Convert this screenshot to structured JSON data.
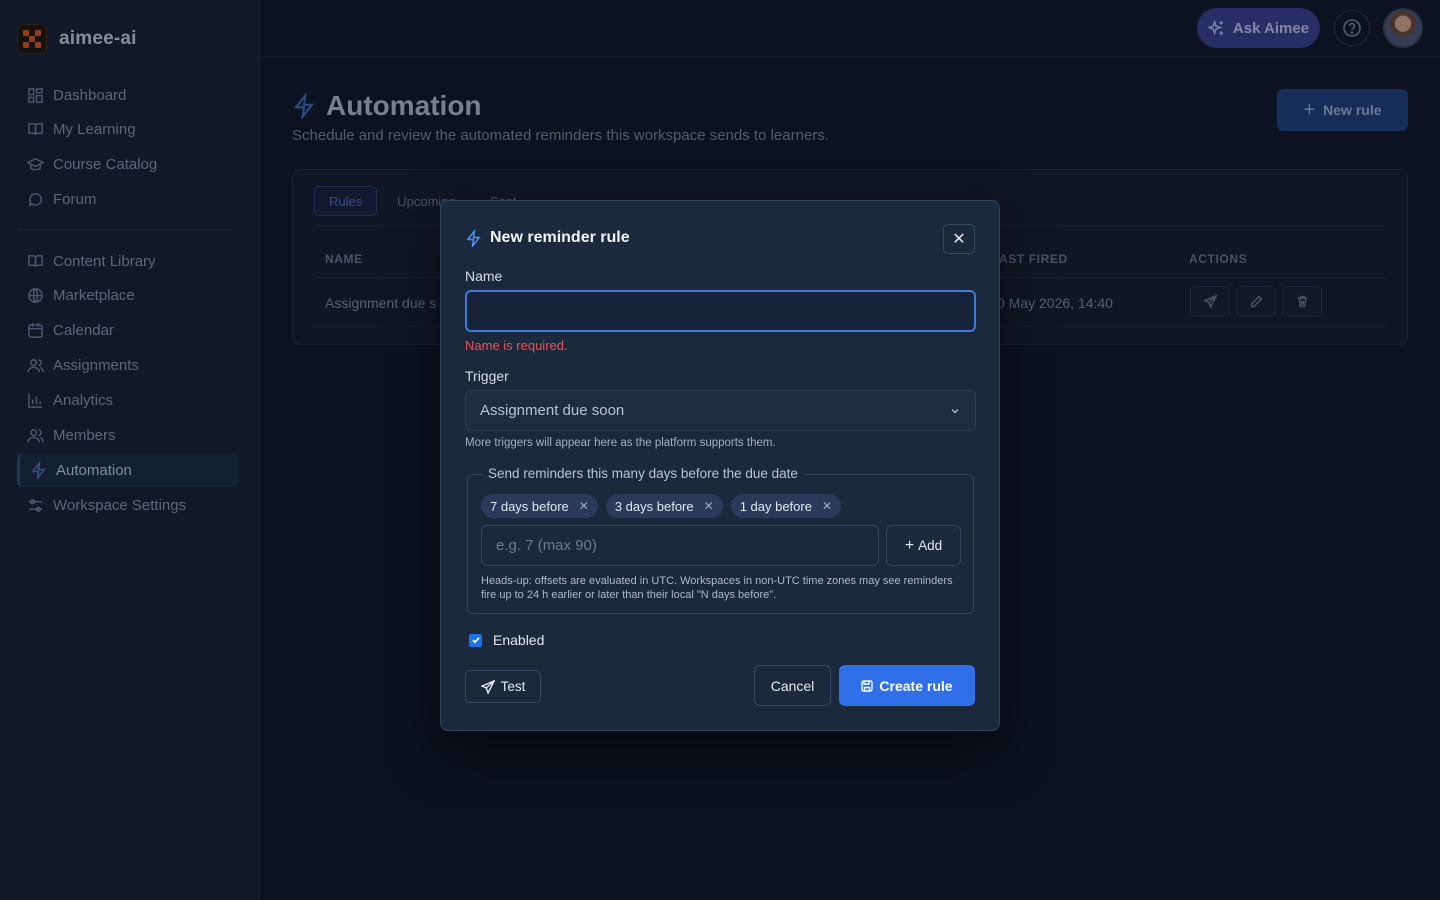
{
  "brand": {
    "name": "aimee-ai",
    "logo_icon": "aimee-logo-icon"
  },
  "sidebar": {
    "items": [
      {
        "label": "Dashboard",
        "icon": "dashboard-icon"
      },
      {
        "label": "My Learning",
        "icon": "book-open-icon"
      },
      {
        "label": "Course Catalog",
        "icon": "graduation-cap-icon"
      },
      {
        "label": "Forum",
        "icon": "chat-bubble-icon"
      }
    ],
    "items2": [
      {
        "label": "Content Library",
        "icon": "book-open-icon"
      },
      {
        "label": "Marketplace",
        "icon": "globe-icon"
      },
      {
        "label": "Calendar",
        "icon": "calendar-icon"
      },
      {
        "label": "Assignments",
        "icon": "users-icon"
      },
      {
        "label": "Analytics",
        "icon": "bar-chart-icon"
      },
      {
        "label": "Members",
        "icon": "users-icon"
      },
      {
        "label": "Automation",
        "icon": "lightning-icon",
        "active": true
      },
      {
        "label": "Workspace Settings",
        "icon": "sliders-icon"
      }
    ]
  },
  "topbar": {
    "ask_label": "Ask Aimee"
  },
  "page": {
    "title": "Automation",
    "subtitle": "Schedule and review the automated reminders this workspace sends to learners.",
    "new_rule_label": "New rule",
    "tabs": [
      "Rules",
      "Upcoming",
      "Sent"
    ],
    "columns": {
      "name": "NAME",
      "last_fired": "AST FIRED",
      "actions": "ACTIONS"
    },
    "row": {
      "name": "Assignment due s",
      "last_fired": "0 May 2026, 14:40"
    }
  },
  "modal": {
    "title": "New reminder rule",
    "close_label": "✕",
    "name_label": "Name",
    "name_value": "",
    "name_error": "Name is required.",
    "trigger_label": "Trigger",
    "trigger_value": "Assignment due soon",
    "trigger_hint": "More triggers will appear here as the platform supports them.",
    "offsets_legend": "Send reminders this many days before the due date",
    "chips": [
      "7 days before",
      "3 days before",
      "1 day before"
    ],
    "days_placeholder": "e.g. 7 (max 90)",
    "add_label": "Add",
    "headsup": "Heads-up: offsets are evaluated in UTC. Workspaces in non-UTC time zones may see reminders fire up to 24 h earlier or later than their local \"N days before\".",
    "enabled_label": "Enabled",
    "enabled": true,
    "test_label": "Test",
    "cancel_label": "Cancel",
    "create_label": "Create rule"
  },
  "colors": {
    "accent": "#2f6fe8",
    "error": "#f05252",
    "ask_button": "#3b3f8f"
  }
}
